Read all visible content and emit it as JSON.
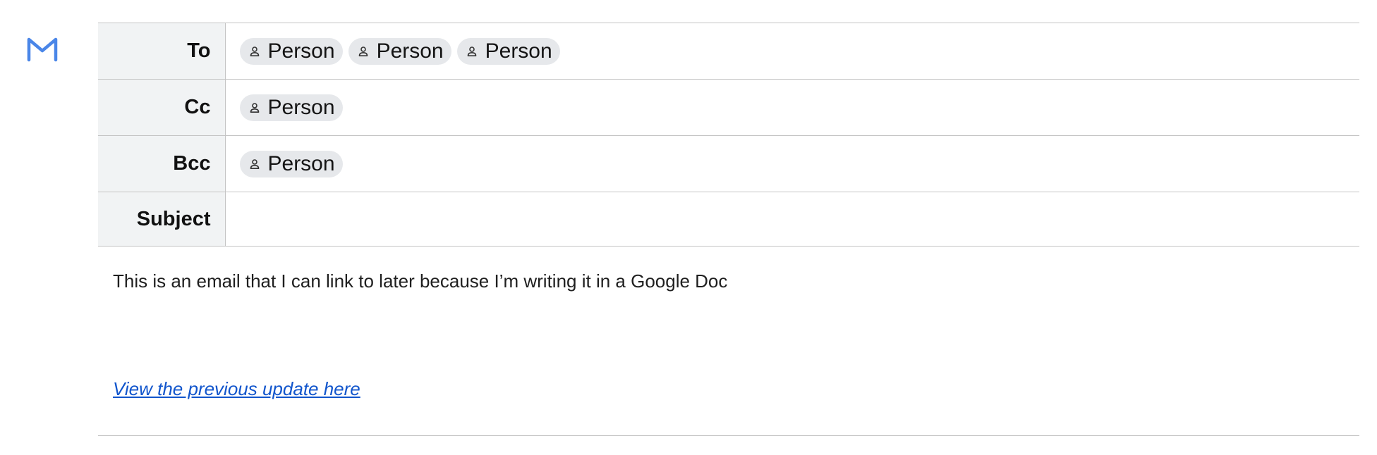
{
  "colors": {
    "logo": "#4a86e8",
    "label_bg": "#f1f3f4",
    "chip_bg": "#e6e8eb",
    "link": "#1155cc",
    "border": "#c4c4c4"
  },
  "logo": {
    "icon": "gmail-m-icon"
  },
  "header": {
    "to": {
      "label": "To",
      "chips": [
        "Person",
        "Person",
        "Person"
      ]
    },
    "cc": {
      "label": "Cc",
      "chips": [
        "Person"
      ]
    },
    "bcc": {
      "label": "Bcc",
      "chips": [
        "Person"
      ]
    },
    "subject": {
      "label": "Subject",
      "value": ""
    }
  },
  "body": {
    "text": "This is an email that I can link to later because I’m writing it in a Google Doc",
    "link_text": "View the previous update here"
  }
}
